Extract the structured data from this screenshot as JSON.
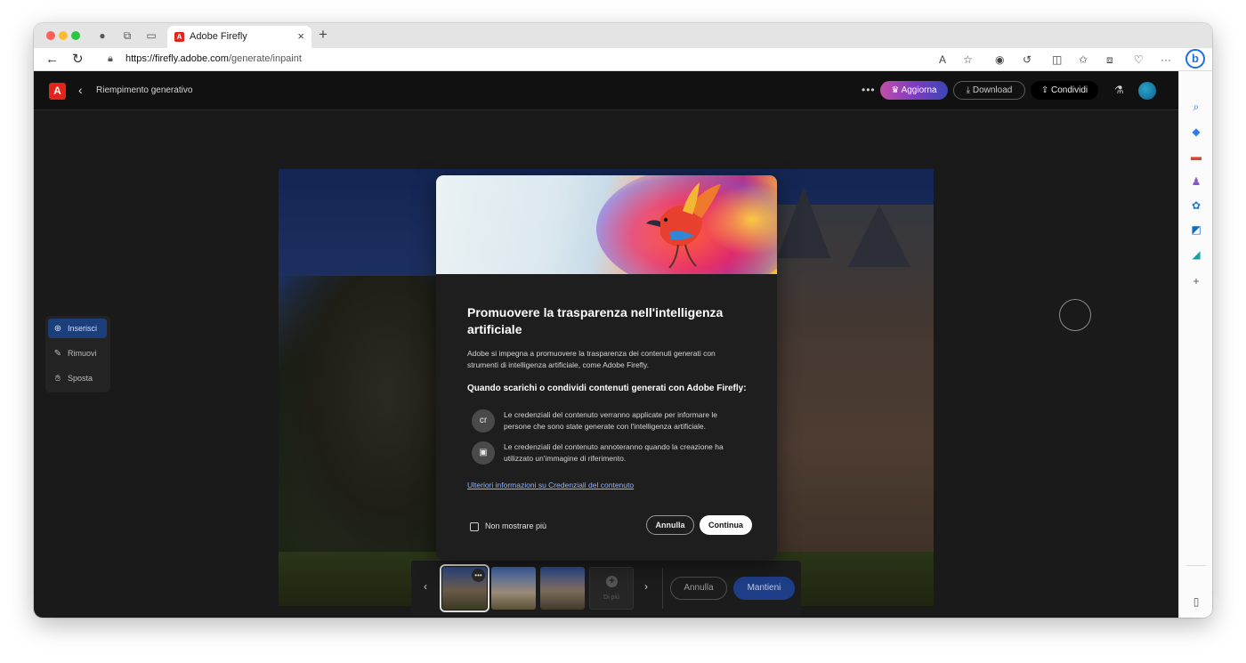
{
  "browser": {
    "tab_title": "Adobe Firefly",
    "tab_favicon": "A",
    "url_domain": "https://firefly.adobe.com",
    "url_path": "/generate/inpaint",
    "sidebar_plus": "+"
  },
  "app": {
    "title": "Riempimento generativo",
    "logo": "A",
    "upgrade_label": "Aggiorna",
    "download_label": "Download",
    "share_label": "Condividi"
  },
  "tools": [
    {
      "label": "Inserisci",
      "icon": "insert-icon"
    },
    {
      "label": "Rimuovi",
      "icon": "eraser-icon"
    },
    {
      "label": "Sposta",
      "icon": "hand-icon"
    }
  ],
  "strip": {
    "more_label": "Di più",
    "cancel_label": "Annulla",
    "keep_label": "Mantieni"
  },
  "modal": {
    "title": "Promuovere la trasparenza nell'intelligenza artificiale",
    "description": "Adobe si impegna a promuovere la trasparenza dei contenuti generati con strumenti di intelligenza artificiale, come Adobe Firefly.",
    "subtitle": "Quando scarichi o condividi contenuti generati con Adobe Firefly:",
    "features": [
      {
        "icon": "content-credentials-icon",
        "glyph": "cr",
        "text": "Le credenziali del contenuto verranno applicate per informare le persone che sono state generate con l'intelligenza artificiale."
      },
      {
        "icon": "reference-image-icon",
        "glyph": "▣",
        "text": "Le credenziali del contenuto annoteranno quando la creazione ha utilizzato un'immagine di riferimento."
      }
    ],
    "link": "Ulteriori informazioni su Credenziali del contenuto",
    "checkbox_label": "Non mostrare più",
    "cancel_label": "Annulla",
    "continue_label": "Continua"
  },
  "colors": {
    "accent_blue": "#1e3e88",
    "adobe_red": "#e1251b",
    "link": "#8fb4ff"
  }
}
